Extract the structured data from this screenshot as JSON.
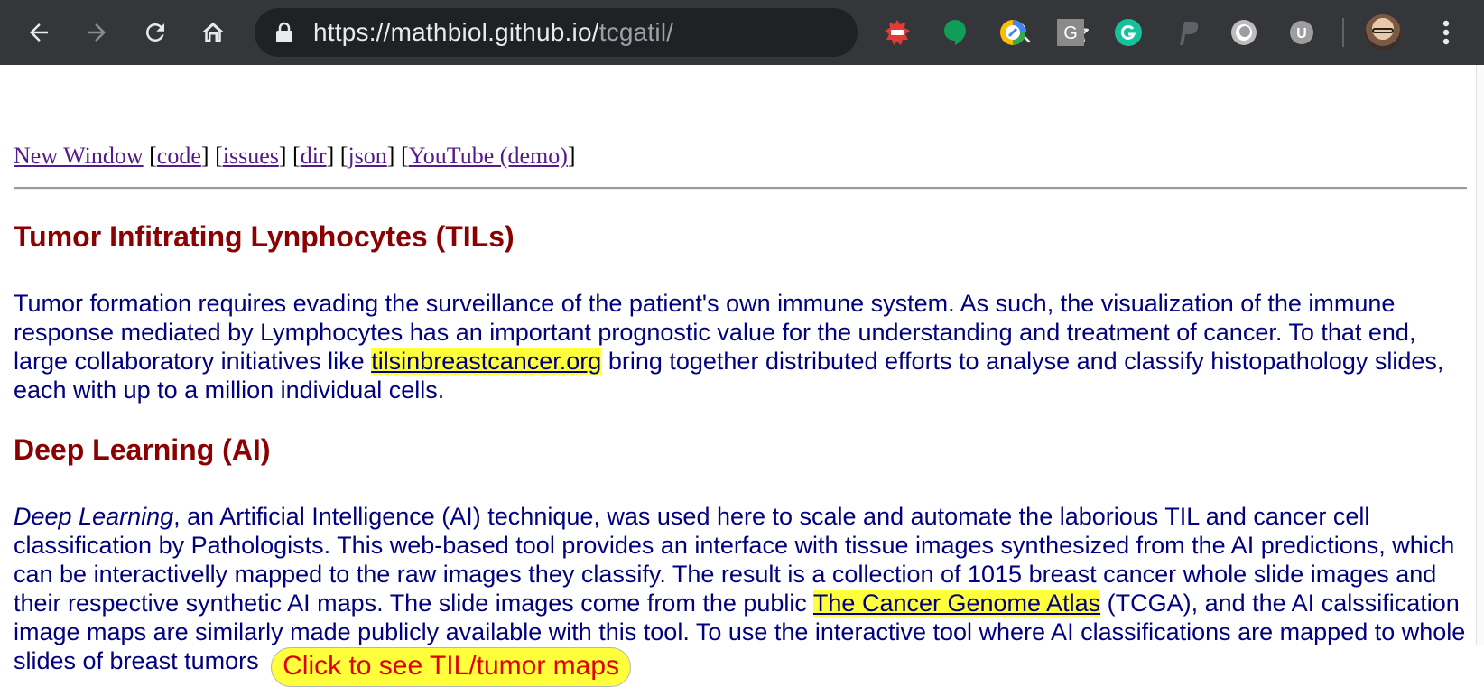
{
  "browser": {
    "url_main": "https://mathbiol.github.io/",
    "url_path": "tcgatil/",
    "extensions": [
      "red-badge-extension-icon",
      "hangouts-icon",
      "google-drive-extension-icon",
      "g-square-extension-icon",
      "grammarly-icon",
      "paypal-icon",
      "circle-extension-icon",
      "u-extension-icon"
    ],
    "colors": {
      "toolbar": "#35363a",
      "omnibox": "#202124"
    }
  },
  "nav": {
    "new_window": "New Window",
    "code": "code",
    "issues": "issues",
    "dir": "dir",
    "json": "json",
    "youtube": "YouTube (demo)",
    "open_bracket": "[",
    "close_bracket": "]"
  },
  "section1": {
    "heading": "Tumor Infitrating Lynphocytes (TILs)",
    "text_a": "Tumor formation requires evading the surveillance of the patient's own immune system. As such, the visualization of the immune response mediated by Lymphocytes has an important prognostic value for the understanding and treatment of cancer. To that end, large collaboratory initiatives like ",
    "link": "tilsinbreastcancer.org",
    "text_b": " bring together distributed efforts to analyse and classify histopathology slides, each with up to a million individual cells."
  },
  "section2": {
    "heading": "Deep Learning (AI)",
    "em": "Deep Learning",
    "text_a": ", an Artificial Intelligence (AI) technique, was used here to scale and automate the laborious TIL and cancer cell classification by Pathologists. This web-based tool provides an interface with tissue images synthesized from the AI predictions, which can be interactivelly mapped to the raw images they classify. The result is a collection of 1015 breast cancer whole slide images and their respective synthetic AI maps. The slide images come from the public ",
    "link": "The Cancer Genome Atlas",
    "text_b": " (TCGA), and the AI calssification image maps are similarly made publicly available with this tool. To use the interactive tool where AI classifications are mapped to whole slides of breast tumors ",
    "button": "Click to see TIL/tumor maps"
  },
  "colors": {
    "heading": "#8b0000",
    "body_text": "#000080",
    "highlight": "#ffff3b",
    "button_text": "#e00000",
    "visited_link": "#551a8b"
  }
}
